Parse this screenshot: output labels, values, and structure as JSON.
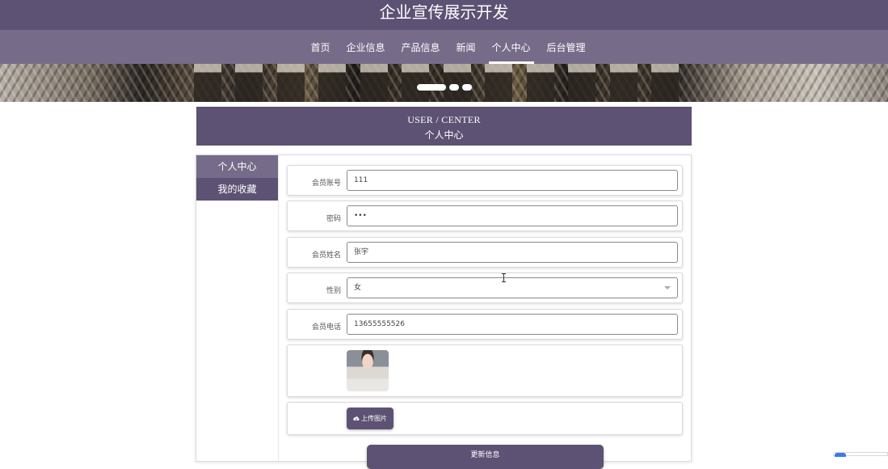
{
  "site": {
    "title": "企业宣传展示开发"
  },
  "nav": {
    "items": [
      "首页",
      "企业信息",
      "产品信息",
      "新闻",
      "个人中心",
      "后台管理"
    ],
    "active_index": 4
  },
  "banner": {
    "slides": 3,
    "active_slide": 0
  },
  "center_header": {
    "en": "USER / CENTER",
    "cn": "个人中心"
  },
  "side_menu": {
    "items": [
      "个人中心",
      "我的收藏"
    ]
  },
  "form": {
    "account_label": "会员账号",
    "account_value": "111",
    "password_label": "密码",
    "password_value": "•••",
    "name_label": "会员姓名",
    "name_value": "张宇",
    "gender_label": "性别",
    "gender_value": "女",
    "phone_label": "会员电话",
    "phone_value": "13655555526",
    "upload_label": "上传图片",
    "update_label": "更新信息"
  },
  "colors": {
    "primary": "#5d5274",
    "secondary": "#766c8a"
  },
  "icons": {
    "upload": "cloud-upload-icon",
    "select": "chevron-down-icon"
  }
}
